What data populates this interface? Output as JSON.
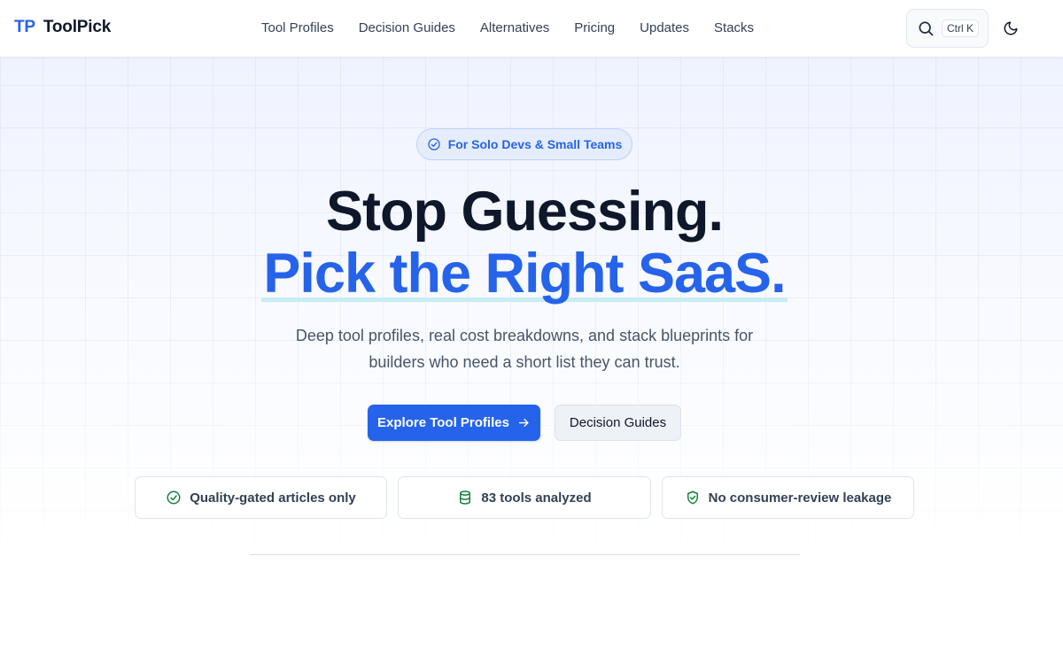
{
  "header": {
    "logo_mark": "TP",
    "logo_text": "ToolPick",
    "nav": [
      "Tool Profiles",
      "Decision Guides",
      "Alternatives",
      "Pricing",
      "Updates",
      "Stacks"
    ],
    "search_shortcut": "Ctrl K"
  },
  "hero": {
    "badge": "For Solo Devs & Small Teams",
    "headline_line1": "Stop Guessing.",
    "headline_line2": "Pick the Right SaaS.",
    "subtext_line1": "Deep tool profiles, real cost breakdowns, and stack blueprints for",
    "subtext_line2": "builders who need a short list they can trust.",
    "primary_cta": "Explore Tool Profiles",
    "secondary_cta": "Decision Guides"
  },
  "features": [
    {
      "label": "Quality-gated articles only",
      "icon": "check-circle-icon"
    },
    {
      "label": "83 tools analyzed",
      "icon": "database-icon"
    },
    {
      "label": "No consumer-review leakage",
      "icon": "shield-check-icon"
    }
  ],
  "colors": {
    "accent": "#2563eb",
    "feature_icon": "#15803d",
    "headline": "#0f172a",
    "underline": "#c7ecf4"
  }
}
